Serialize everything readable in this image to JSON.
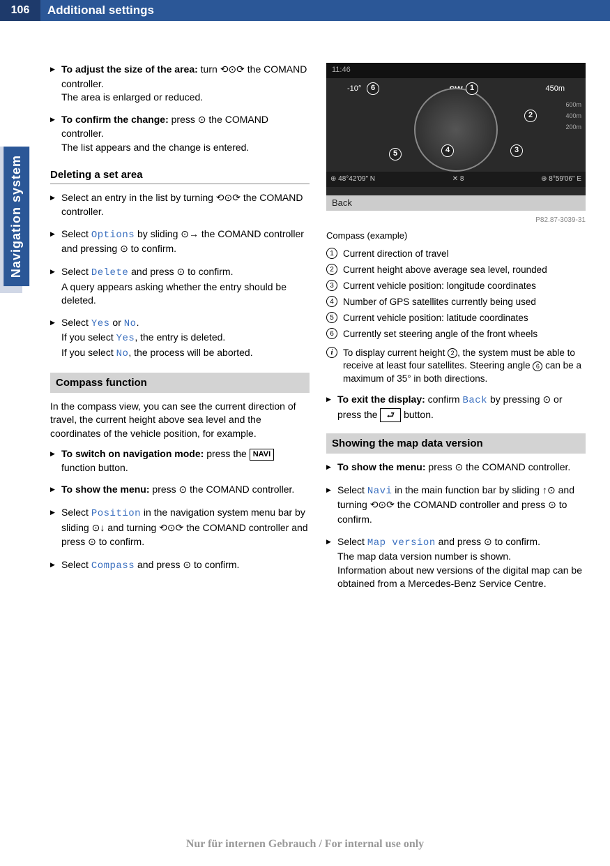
{
  "page": {
    "number": "106",
    "title": "Additional settings",
    "sidetab": "Navigation system"
  },
  "col1": {
    "adjust": {
      "lead": "To adjust the size of the area:",
      "rest": " turn ",
      "controller": " the COMAND controller.",
      "result": "The area is enlarged or reduced."
    },
    "confirm": {
      "lead": "To confirm the change:",
      "rest": " press ",
      "controller": " the COMAND controller.",
      "result": "The list appears and the change is entered."
    },
    "delhead": "Deleting a set area",
    "del1": {
      "a": "Select an entry in the list by turning ",
      "b": " the COMAND controller."
    },
    "del2": {
      "a": "Select ",
      "opt": "Options",
      "b": " by sliding ",
      "c": " the COMAND controller and pressing ",
      "d": " to confirm."
    },
    "del3": {
      "a": "Select ",
      "del": "Delete",
      "b": " and press ",
      "c": " to confirm.",
      "result": "A query appears asking whether the entry should be deleted."
    },
    "del4": {
      "a": "Select ",
      "yes": "Yes",
      "or": " or ",
      "no": "No",
      "dot": ".",
      "ifyes_a": "If you select ",
      "ifyes_b": ", the entry is deleted.",
      "ifno_a": "If you select ",
      "ifno_b": ", the process will be aborted."
    },
    "compasshead": "Compass function",
    "compass_intro": "In the compass view, you can see the current direction of travel, the current height above sea level and the coordinates of the vehicle position, for example.",
    "nav_on": {
      "lead": "To switch on navigation mode:",
      "rest": " press the ",
      "navi": "NAVI",
      "end": " function button."
    },
    "showmenu": {
      "lead": "To show the menu:",
      "rest": " press ",
      "end": " the COMAND controller."
    },
    "pos": {
      "a": "Select ",
      "pos": "Position",
      "b": " in the navigation system menu bar by sliding ",
      "c": " and turning ",
      "d": " the COMAND controller and press ",
      "e": " to confirm."
    },
    "comp": {
      "a": "Select ",
      "compass": "Compass",
      "b": " and press ",
      "c": " to confirm."
    }
  },
  "screenshot": {
    "time": "11:46",
    "angle": "-10°",
    "sw": "SW",
    "dist": "450m",
    "alt1": "600m",
    "alt2": "400m",
    "alt3": "200m",
    "lat": "48°42'09\" N",
    "sats": "8",
    "lon": "8°59'06\" E",
    "back": "Back",
    "imgid": "P82.87-3039-31"
  },
  "col2": {
    "caption": "Compass (example)",
    "l1": "Current direction of travel",
    "l2": "Current height above average sea level, rounded",
    "l3": "Current vehicle position: longitude coordinates",
    "l4": "Number of GPS satellites currently being used",
    "l5": "Current vehicle position: latitude coordinates",
    "l6": "Currently set steering angle of the front wheels",
    "info_a": "To display current height ",
    "info_b": ", the system must be able to receive at least four satellites. Steering angle ",
    "info_c": " can be a maximum of 35° in both directions.",
    "exit": {
      "lead": "To exit the display:",
      "a": " confirm ",
      "back": "Back",
      "b": " by pressing ",
      "c": " or press the ",
      "btn": "⮐",
      "d": " button."
    },
    "maphead": "Showing the map data version",
    "showmenu": {
      "lead": "To show the menu:",
      "rest": " press ",
      "end": " the COMAND controller."
    },
    "navi": {
      "a": "Select ",
      "n": "Navi",
      "b": " in the main function bar by sliding ",
      "c": " and turning ",
      "d": " the COMAND controller and press ",
      "e": " to confirm."
    },
    "mapv": {
      "a": "Select ",
      "mv": "Map version",
      "b": " and press ",
      "c": " to confirm.",
      "res1": "The map data version number is shown.",
      "res2": "Information about new versions of the digital map can be obtained from a Mercedes-Benz Service Centre."
    }
  },
  "watermark": "Nur für internen Gebrauch / For internal use only"
}
